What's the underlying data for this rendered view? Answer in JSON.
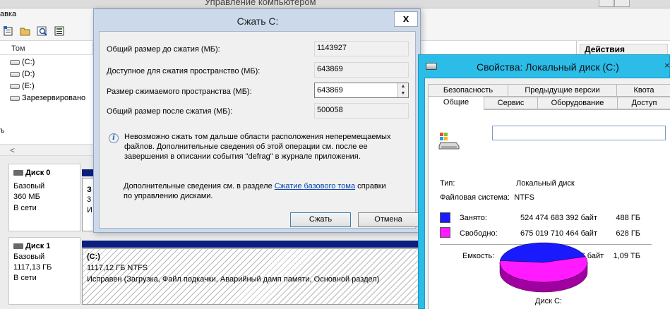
{
  "mmc": {
    "title_fragment": "Управление компьютером",
    "menu_fragment": "авка",
    "toolbar_icons": [
      "properties-icon",
      "open-folder-icon",
      "find-icon",
      "export-icon"
    ],
    "list_header": "Том",
    "volumes": [
      {
        "name": "(C:)",
        "icon": "drive-icon"
      },
      {
        "name": "(D:)",
        "icon": "drive-icon"
      },
      {
        "name": "(E:)",
        "icon": "drive-icon"
      },
      {
        "name": "Зарезервировано",
        "icon": "drive-icon"
      }
    ],
    "side_fragment_1": "т",
    "side_fragment_2": "ъ",
    "actions_header": "Действия",
    "disks": [
      {
        "title": "Диск 0",
        "type": "Базовый",
        "size": "360 МБ",
        "status": "В сети",
        "partition_fragments": [
          "З",
          "3",
          "И"
        ]
      },
      {
        "title": "Диск 1",
        "type": "Базовый",
        "size": "1117,13 ГБ",
        "status": "В сети",
        "partition": {
          "label": "(C:)",
          "size_fs": "1117,12 ГБ NTFS",
          "status": "Исправен (Загрузка, Файл подкачки, Аварийный дамп памяти, Основной раздел)"
        }
      }
    ]
  },
  "shrink_dialog": {
    "title": "Сжать С:",
    "close_glyph": "x",
    "fields": [
      {
        "label": "Общий размер до сжатия (МБ):",
        "value": "1143927"
      },
      {
        "label": "Доступное для сжатия пространство (МБ):",
        "value": "643869"
      },
      {
        "label": "Размер сжимаемого пространства (МБ):",
        "value": "643869"
      },
      {
        "label": "Общий размер после сжатия (МБ):",
        "value": "500058"
      }
    ],
    "info_lines": [
      "Невозможно сжать том дальше области расположения неперемещаемых",
      "файлов. Дополнительные сведения об этой операции см. после ее",
      "завершения в описании события \"defrag\" в журнале приложения."
    ],
    "more_info_prefix": "Дополнительные сведения см. в разделе ",
    "more_info_link": "Сжатие базового тома",
    "more_info_suffix": " справки",
    "more_info_line2": "по управлению дисками.",
    "shrink_button": "Сжать",
    "cancel_button": "Отмена"
  },
  "properties_dialog": {
    "title": "Свойства: Локальный диск (C:)",
    "close_glyph": "×",
    "tabs_row1": [
      "Безопасность",
      "Предыдущие версии",
      "Квота"
    ],
    "tabs_row2": [
      "Общие",
      "Сервис",
      "Оборудование",
      "Доступ"
    ],
    "active_tab": "Общие",
    "volume_label_value": "",
    "type_label": "Тип:",
    "type_value": "Локальный диск",
    "fs_label": "Файловая система:",
    "fs_value": "NTFS",
    "used_label": "Занято:",
    "used_bytes": "524 474 683 392 байт",
    "used_gb": "488 ГБ",
    "free_label": "Свободно:",
    "free_bytes": "675 019 710 464 байт",
    "free_gb": "628 ГБ",
    "capacity_label": "Емкость:",
    "capacity_bytes": "1 199 494 393 856 байт",
    "capacity_tb": "1,09 ТБ",
    "disk_caption": "Диск С:",
    "used_fraction": 0.437,
    "colors": {
      "used": "#1a1aff",
      "free": "#ff1aff",
      "used_side": "#0000a0",
      "free_side": "#a000a0"
    }
  }
}
